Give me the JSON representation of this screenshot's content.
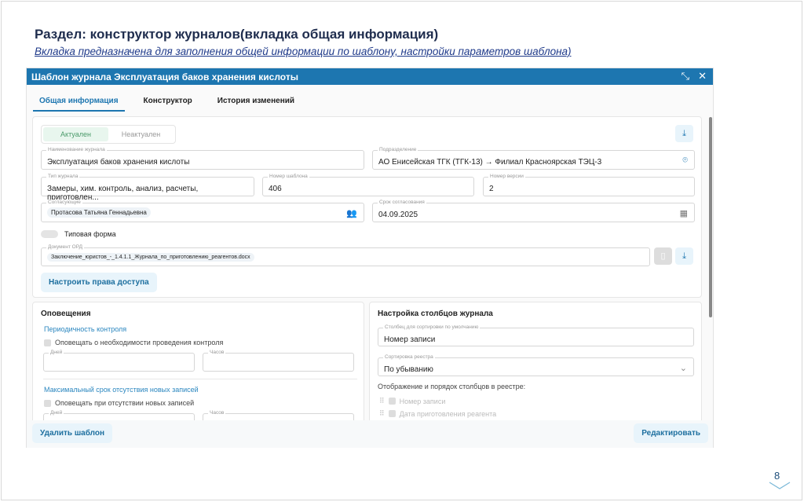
{
  "slide": {
    "title": "Раздел: конструктор журналов(вкладка общая информация)",
    "subtitle": "Вкладка предназначена для заполнения общей информации по шаблону, настройки параметров шаблона)",
    "page": "8"
  },
  "modal": {
    "title": "Шаблон журнала Эксплуатация баков хранения кислоты",
    "tabs": [
      "Общая информация",
      "Конструктор",
      "История изменений"
    ],
    "status": [
      "Актуален",
      "Неактуален"
    ],
    "fields": {
      "name": {
        "label": "Наименование журнала",
        "value": "Эксплуатация баков хранения кислоты"
      },
      "division": {
        "label": "Подразделение",
        "value": "АО Енисейская ТГК (ТГК-13) → Филиал Красноярская ТЭЦ-3"
      },
      "type": {
        "label": "Тип журнала",
        "value": "Замеры, хим. контроль, анализ, расчеты, приготовлен..."
      },
      "template_no": {
        "label": "Номер шаблона",
        "value": "406"
      },
      "version": {
        "label": "Номер версии",
        "value": "2"
      },
      "approvers": {
        "label": "Согласующие",
        "value": "Протасова Татьяна Геннадьевна"
      },
      "deadline": {
        "label": "Срок согласования",
        "value": "04.09.2025"
      },
      "doc": {
        "label": "Документ ОРД",
        "value": "Заключение_юристов_-_1.4.1.1_Журнала_по_приготовлению_реагентов.docx"
      }
    },
    "typical_form": "Типовая форма",
    "access_button": "Настроить права доступа",
    "notifications": {
      "title": "Оповещения",
      "periodicity": "Периодичность контроля",
      "notify_control": "Оповещать о необходимости проведения контроля",
      "days": "Дней",
      "hours": "Часов",
      "max_period": "Максимальный срок отсутствия новых записей",
      "notify_absent": "Оповещать при отсутствии новых записей"
    },
    "columns": {
      "title": "Настройка столбцов журнала",
      "sort_col_label": "Столбец для сортировки по умолчанию",
      "sort_col": "Номер записи",
      "sort_label": "Сортировка реестра",
      "sort": "По убыванию",
      "display": "Отображение и порядок столбцов в реестре:",
      "items": [
        "Номер записи",
        "Дата приготовления реагента"
      ]
    },
    "delete_button": "Удалить шаблон",
    "edit_button": "Редактировать"
  }
}
